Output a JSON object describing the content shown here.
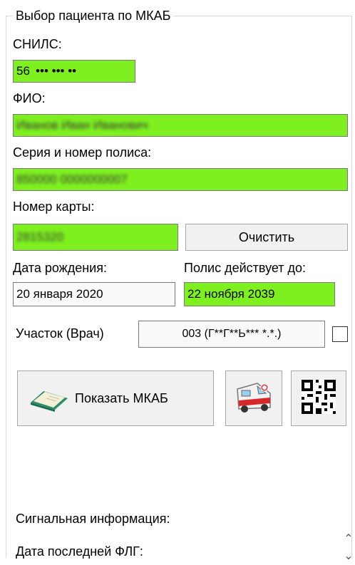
{
  "group_title": "Выбор пациента по МКАБ",
  "snils": {
    "label": "СНИЛС:",
    "value": "56  ••• ••• ••"
  },
  "fio": {
    "label": "ФИО:",
    "value": "Иванов Иван Иванович"
  },
  "policy": {
    "label": "Серия и номер полиса:",
    "value": "850000 0000000007"
  },
  "card": {
    "label": "Номер карты:",
    "value": "2815320",
    "clear_label": "Очистить"
  },
  "birth": {
    "label": "Дата рождения:",
    "value": "20 января 2020"
  },
  "policy_valid": {
    "label": "Полис действует до:",
    "value": "22 ноября 2039"
  },
  "district": {
    "label": "Участок (Врач)",
    "value": "003 (Г**Г**Ь*** *.*.)"
  },
  "buttons": {
    "show_mkab_label": "Показать МКАБ"
  },
  "info": {
    "signal_label": "Сигнальная  информация:",
    "flg_label": "Дата последней ФЛГ:"
  },
  "icons": {
    "book": "book-icon",
    "ambulance": "ambulance-icon",
    "qr": "qr-code-icon"
  },
  "colors": {
    "highlight": "#7ef01f"
  }
}
